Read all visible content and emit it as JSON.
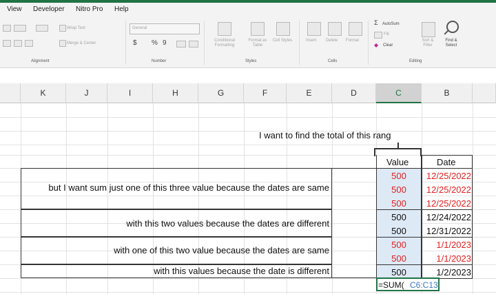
{
  "menu": [
    "View",
    "Developer",
    "Nitro Pro",
    "Help"
  ],
  "ribbon": {
    "wrap_text": "Wrap Text",
    "merge_center": "Merge & Center",
    "number_format": "General",
    "currency": "$",
    "percent": "%",
    "comma": "9",
    "conditional_formatting": "Conditional Formatting",
    "format_as_table": "Format as Table",
    "cell_styles": "Cell Styles",
    "insert": "Insert",
    "delete": "Delete",
    "format": "Format",
    "autosum": "AutoSum",
    "fill": "Fill",
    "clear": "Clear",
    "sort_filter": "Sort & Filter",
    "find_select": "Find & Select",
    "groups": [
      "Alignment",
      "Number",
      "Styles",
      "Cells",
      "Editing"
    ]
  },
  "columns": [
    "K",
    "J",
    "I",
    "H",
    "G",
    "F",
    "E",
    "D",
    "C",
    "B"
  ],
  "sheet": {
    "note": "I want to find the total of this rang",
    "value_header": "Value",
    "date_header": "Date",
    "values": [
      "500",
      "500",
      "500",
      "500",
      "500",
      "500",
      "500",
      "500"
    ],
    "dates": [
      "12/25/2022",
      "12/25/2022",
      "12/25/2022",
      "12/24/2022",
      "12/31/2022",
      "1/1/2023",
      "1/1/2023",
      "1/2/2023"
    ],
    "highlight_color": "#e02020",
    "explanations": [
      "but I want sum just one of this three value because the dates are same",
      "with this two values because the dates are different",
      "with one of this two value because the dates are same",
      "with this values because the date is different"
    ],
    "formula_prefix": "=SUM(",
    "formula_range": "C6:C13"
  }
}
